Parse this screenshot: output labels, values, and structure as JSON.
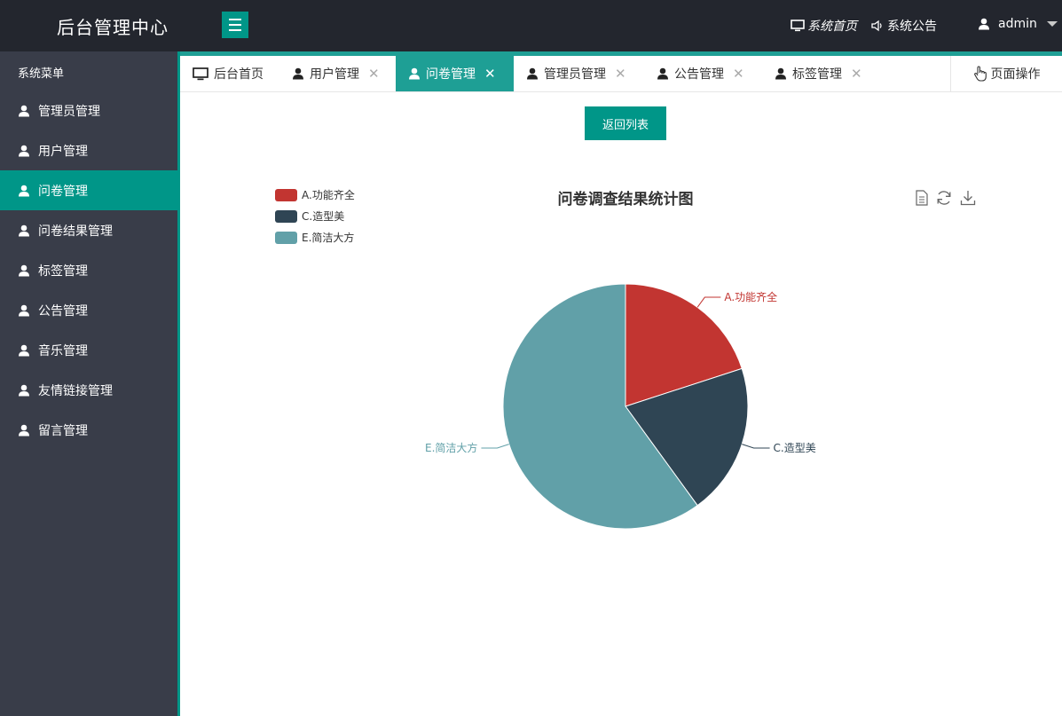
{
  "header": {
    "title": "后台管理中心",
    "home_link": "系统首页",
    "notice_link": "系统公告",
    "username": "admin"
  },
  "sidebar": {
    "title": "系统菜单",
    "active_index": 2,
    "items": [
      {
        "label": "管理员管理"
      },
      {
        "label": "用户管理"
      },
      {
        "label": "问卷管理"
      },
      {
        "label": "问卷结果管理"
      },
      {
        "label": "标签管理"
      },
      {
        "label": "公告管理"
      },
      {
        "label": "音乐管理"
      },
      {
        "label": "友情链接管理"
      },
      {
        "label": "留言管理"
      }
    ]
  },
  "tabs": {
    "items": [
      {
        "label": "后台首页",
        "icon": "monitor-icon"
      },
      {
        "label": "用户管理",
        "icon": "user-icon"
      },
      {
        "label": "问卷管理",
        "icon": "user-icon"
      },
      {
        "label": "管理员管理",
        "icon": "user-icon"
      },
      {
        "label": "公告管理",
        "icon": "user-icon"
      },
      {
        "label": "标签管理",
        "icon": "user-icon"
      }
    ],
    "active_index": 2,
    "operation_label": "页面操作"
  },
  "content": {
    "back_button": "返回列表"
  },
  "chart_data": {
    "type": "pie",
    "title": "问卷调查结果统计图",
    "categories": [
      "A.功能齐全",
      "C.造型美",
      "E.简洁大方"
    ],
    "values": [
      1,
      1,
      3
    ],
    "colors": [
      "#c23531",
      "#2f4554",
      "#61a0a8"
    ],
    "legend": "top-left"
  },
  "colors": {
    "accent": "#009688",
    "header_bg": "#23262e",
    "sidebar_bg": "#393d49"
  }
}
